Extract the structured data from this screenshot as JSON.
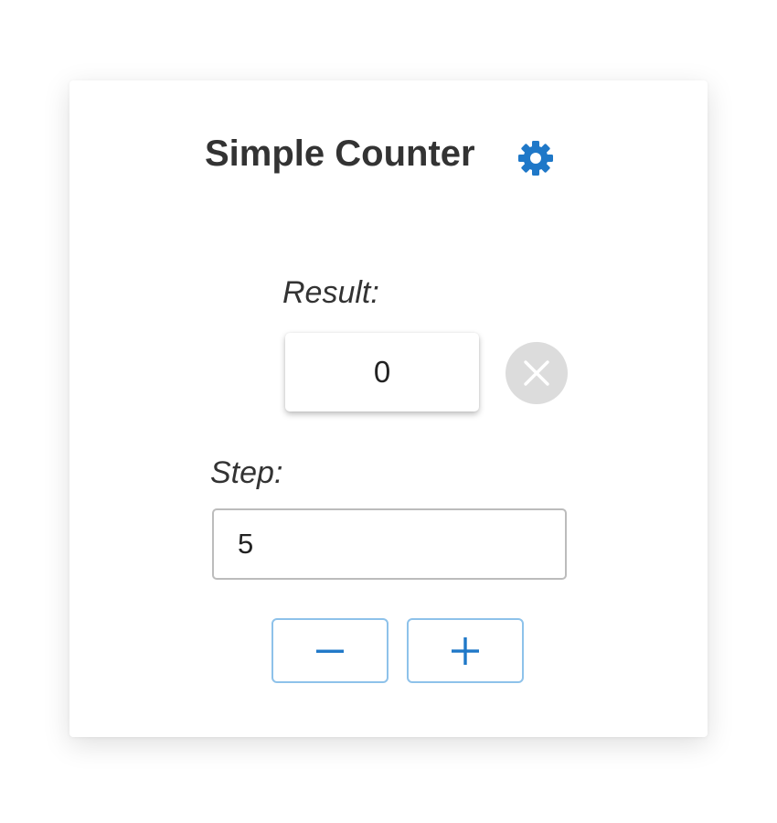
{
  "counter": {
    "title": "Simple Counter",
    "settings_icon": "gear-icon",
    "result_label": "Result:",
    "result_value": "0",
    "clear_icon": "close-icon",
    "step_label": "Step:",
    "step_value": "5",
    "decrement_icon": "minus-icon",
    "increment_icon": "plus-icon"
  },
  "colors": {
    "accent": "#1f78c8",
    "button_border": "#8ec2ea",
    "clear_button_bg": "#dcdcdc",
    "text": "#333333"
  }
}
